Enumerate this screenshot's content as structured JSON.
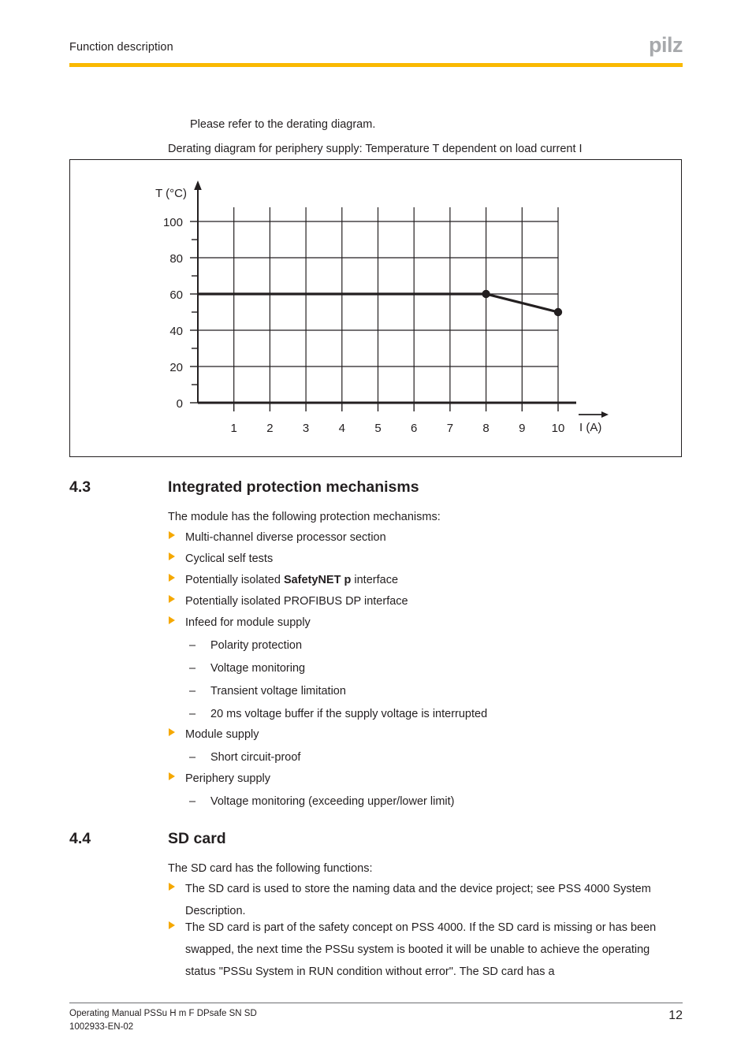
{
  "header": {
    "title": "Function description",
    "logo": "pilz",
    "rule_color": "#fab900"
  },
  "intro": {
    "line1": "Please refer to the derating diagram.",
    "line2": "Derating diagram for periphery supply: Temperature T dependent on load current I"
  },
  "chart_data": {
    "type": "line",
    "title": "Derating diagram for periphery supply: Temperature T dependent on load current I",
    "xlabel": "I (A)",
    "ylabel": "T (°C)",
    "xlim": [
      0,
      10.6
    ],
    "ylim": [
      0,
      107
    ],
    "grid": true,
    "legend": "none",
    "x_ticks": [
      1,
      2,
      3,
      4,
      5,
      6,
      7,
      8,
      9,
      10
    ],
    "y_ticks": [
      0,
      20,
      40,
      60,
      80,
      100
    ],
    "y_minor_ticks": [
      10,
      30,
      50,
      70,
      90
    ],
    "x": [
      0,
      8,
      10
    ],
    "y": [
      60,
      60,
      50
    ],
    "markers_at": [
      {
        "x": 8,
        "y": 60
      },
      {
        "x": 10,
        "y": 50
      }
    ],
    "line_color": "#231f20"
  },
  "section_43": {
    "number": "4.3",
    "title": "Integrated protection mechanisms",
    "lead": "The module has the following protection mechanisms:",
    "items": [
      {
        "level": 1,
        "text": "Multi-channel diverse processor section"
      },
      {
        "level": 1,
        "text": "Cyclical self tests"
      },
      {
        "level": 1,
        "text": "Potentially isolated ",
        "bold": "SafetyNET p",
        "tail": " interface"
      },
      {
        "level": 1,
        "text": "Potentially isolated PROFIBUS DP interface"
      },
      {
        "level": 1,
        "text": "Infeed for module supply"
      },
      {
        "level": 2,
        "text": "Polarity protection"
      },
      {
        "level": 2,
        "text": "Voltage monitoring"
      },
      {
        "level": 2,
        "text": "Transient voltage limitation"
      },
      {
        "level": 2,
        "text": "20 ms voltage buffer if the supply voltage is interrupted"
      },
      {
        "level": 1,
        "text": "Module supply"
      },
      {
        "level": 2,
        "text": "Short circuit-proof"
      },
      {
        "level": 1,
        "text": "Periphery supply"
      },
      {
        "level": 2,
        "text": "Voltage monitoring (exceeding upper/lower limit)"
      }
    ]
  },
  "section_44": {
    "number": "4.4",
    "title": "SD card",
    "lead": "The SD card has the following functions:",
    "items": [
      {
        "text": "The SD card is used to store the naming data and the device project; see PSS 4000 System Description."
      },
      {
        "text": "The SD card is part of the safety concept on PSS 4000. If the SD card is missing or has been swapped, the next time the PSSu system is booted it will be unable to achieve the operating status \"PSSu System in RUN condition without error\". The SD card has a"
      }
    ]
  },
  "footer": {
    "line1": "Operating Manual PSSu H m F DPsafe SN SD",
    "line2": "1002933-EN-02",
    "page_number": "12"
  }
}
